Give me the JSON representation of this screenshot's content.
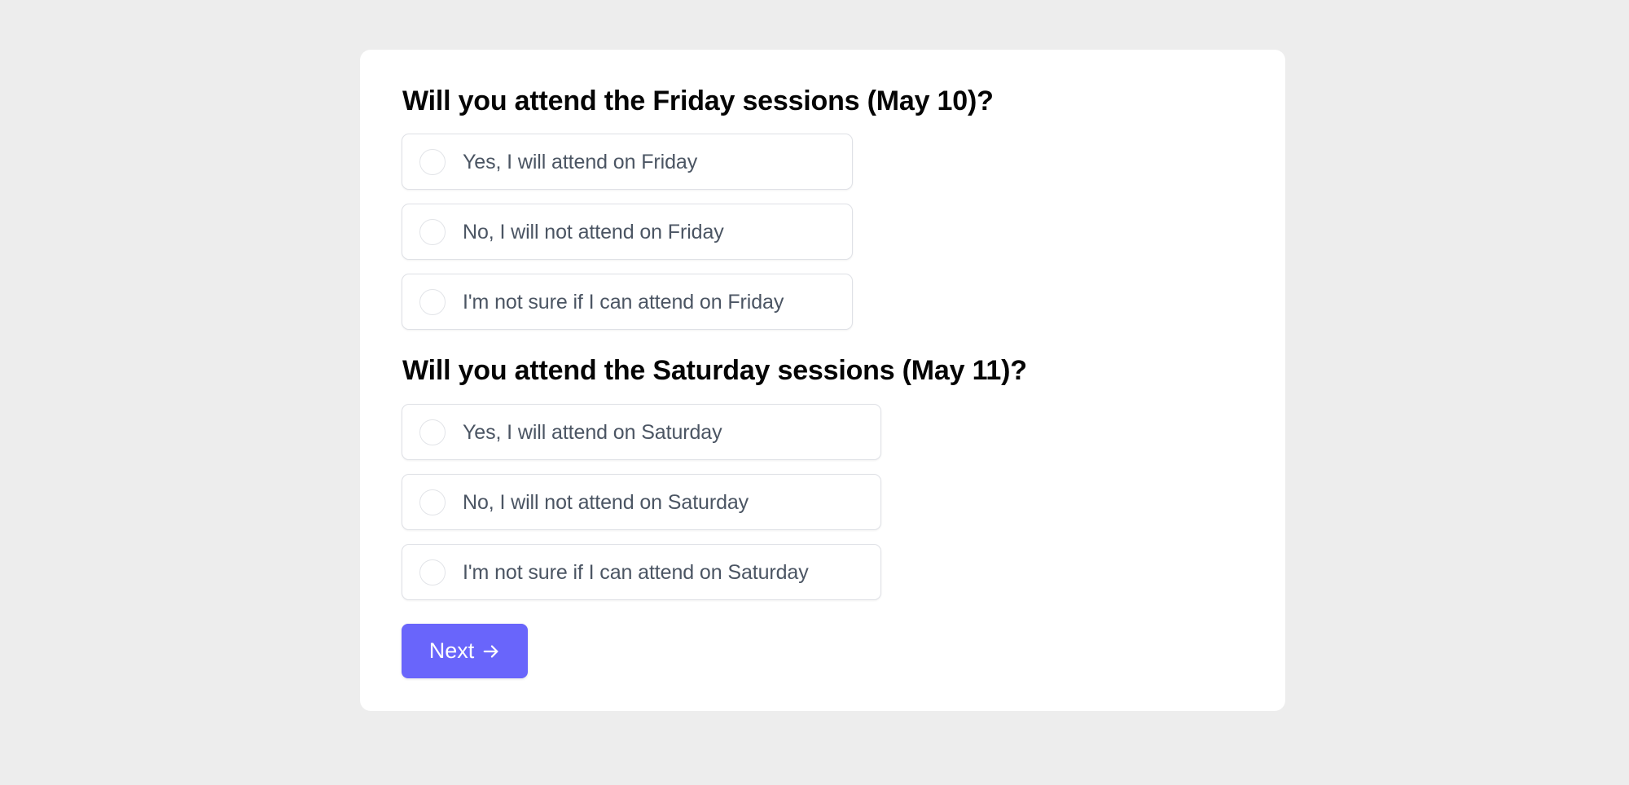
{
  "colors": {
    "page_background": "#ededed",
    "card_background": "#ffffff",
    "accent": "#6965fb",
    "option_text": "#4b5563",
    "heading_text": "#050505"
  },
  "questions": [
    {
      "title": "Will you attend the Friday sessions (May 10)?",
      "options": [
        {
          "label": "Yes, I will attend on Friday",
          "selected": false
        },
        {
          "label": "No, I will not attend on Friday",
          "selected": false
        },
        {
          "label": "I'm not sure if I can attend on Friday",
          "selected": false
        }
      ]
    },
    {
      "title": "Will you attend the Saturday sessions (May 11)?",
      "options": [
        {
          "label": "Yes, I will attend on Saturday",
          "selected": false
        },
        {
          "label": "No, I will not attend on Saturday",
          "selected": false
        },
        {
          "label": "I'm not sure if I can attend on Saturday",
          "selected": false
        }
      ]
    }
  ],
  "next_button": {
    "label": "Next",
    "icon": "arrow-right-icon"
  }
}
